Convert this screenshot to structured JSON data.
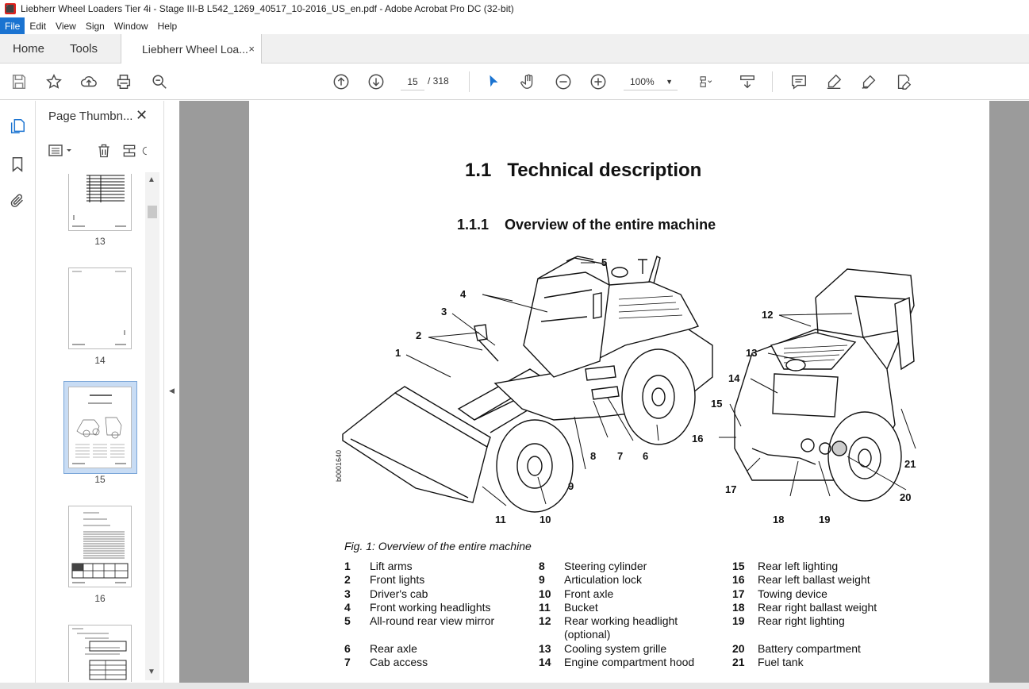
{
  "window": {
    "title": "Liebherr Wheel Loaders Tier 4i - Stage III-B L542_1269_40517_10-2016_US_en.pdf - Adobe Acrobat Pro DC (32-bit)",
    "app_icon": "pdf-icon"
  },
  "menu": {
    "items": [
      "File",
      "Edit",
      "View",
      "Sign",
      "Window",
      "Help"
    ],
    "active": "File"
  },
  "tabs": {
    "home": "Home",
    "tools": "Tools",
    "document": "Liebherr Wheel Loa...",
    "close_glyph": "×"
  },
  "toolbar": {
    "icons": [
      "save-icon",
      "star-icon",
      "upload-icon",
      "print-icon",
      "zoom-search-icon",
      "prev-page-icon",
      "next-page-icon",
      "select-arrow-icon",
      "hand-icon",
      "zoom-out-icon",
      "zoom-in-icon",
      "fit-page-icon",
      "scroll-mode-icon",
      "comment-icon",
      "highlight-icon",
      "sign-icon",
      "edit-icon"
    ],
    "current_page": "15",
    "total_pages": "/ 318",
    "zoom": "100%"
  },
  "sidebar": {
    "panel_title": "Page Thumbn...",
    "close_glyph": "✕",
    "thumbnails": [
      {
        "label": "13"
      },
      {
        "label": "14"
      },
      {
        "label": "15",
        "selected": true
      },
      {
        "label": "16"
      }
    ]
  },
  "document": {
    "heading1_num": "1.1",
    "heading1_text": "Technical description",
    "heading2_num": "1.1.1",
    "heading2_text": "Overview of the entire machine",
    "figure_caption": "Fig. 1: Overview of the entire machine",
    "figure_code": "b0001640",
    "callouts": [
      "1",
      "2",
      "3",
      "4",
      "5",
      "6",
      "7",
      "8",
      "9",
      "10",
      "11",
      "12",
      "13",
      "14",
      "15",
      "16",
      "17",
      "18",
      "19",
      "20",
      "21"
    ],
    "legend_columns": [
      [
        {
          "n": "1",
          "t": "Lift arms"
        },
        {
          "n": "2",
          "t": "Front lights"
        },
        {
          "n": "3",
          "t": "Driver's cab"
        },
        {
          "n": "4",
          "t": "Front working headlights"
        },
        {
          "n": "5",
          "t": "All-round rear view mirror"
        },
        {
          "n": "6",
          "t": "Rear axle"
        },
        {
          "n": "7",
          "t": "Cab access"
        }
      ],
      [
        {
          "n": "8",
          "t": "Steering cylinder"
        },
        {
          "n": "9",
          "t": "Articulation lock"
        },
        {
          "n": "10",
          "t": "Front axle"
        },
        {
          "n": "11",
          "t": "Bucket"
        },
        {
          "n": "12",
          "t": "Rear working headlight (optional)"
        },
        {
          "n": "13",
          "t": "Cooling system grille"
        },
        {
          "n": "14",
          "t": "Engine compartment hood"
        }
      ],
      [
        {
          "n": "15",
          "t": "Rear left lighting"
        },
        {
          "n": "16",
          "t": "Rear left ballast weight"
        },
        {
          "n": "17",
          "t": "Towing device"
        },
        {
          "n": "18",
          "t": "Rear right ballast weight"
        },
        {
          "n": "19",
          "t": "Rear right lighting"
        },
        {
          "n": "20",
          "t": "Battery compartment"
        },
        {
          "n": "21",
          "t": "Fuel tank"
        }
      ]
    ]
  },
  "colors": {
    "accent": "#1a73d1",
    "doc_background": "#9b9b9b",
    "selected_thumb": "#c8dcf4"
  }
}
